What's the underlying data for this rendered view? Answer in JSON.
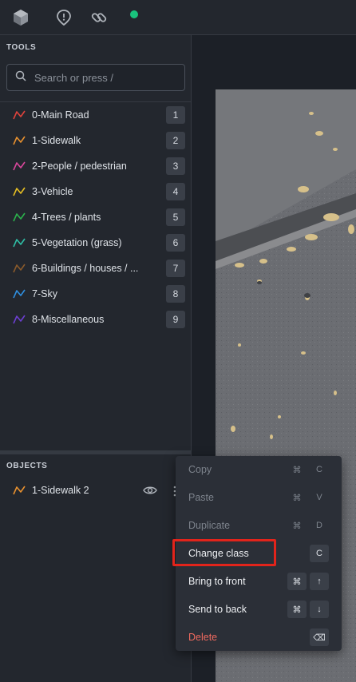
{
  "topbar": {
    "icons": [
      "cube-logo-icon",
      "alert-marker-icon",
      "link-icon",
      "status-dot-icon"
    ],
    "status_color": "#19c37d"
  },
  "tools_panel": {
    "title": "TOOLS",
    "search_placeholder": "Search or press /",
    "items": [
      {
        "label": "0-Main Road",
        "key": "1",
        "color": "#e0433c"
      },
      {
        "label": "1-Sidewalk",
        "key": "2",
        "color": "#e8912f"
      },
      {
        "label": "2-People / pedestrian",
        "key": "3",
        "color": "#d9479c"
      },
      {
        "label": "3-Vehicle",
        "key": "4",
        "color": "#e6bf23"
      },
      {
        "label": "4-Trees / plants",
        "key": "5",
        "color": "#2bb24c"
      },
      {
        "label": "5-Vegetation (grass)",
        "key": "6",
        "color": "#2fbfa6"
      },
      {
        "label": "6-Buildings / houses / ...",
        "key": "7",
        "color": "#8a5a2b"
      },
      {
        "label": "7-Sky",
        "key": "8",
        "color": "#2f8fe0"
      },
      {
        "label": "8-Miscellaneous",
        "key": "9",
        "color": "#6c3fd1"
      }
    ]
  },
  "objects_panel": {
    "title": "OBJECTS",
    "items": [
      {
        "label": "1-Sidewalk 2",
        "color": "#e8912f"
      }
    ]
  },
  "context_menu": {
    "items": [
      {
        "label": "Copy",
        "keys": [
          "⌘",
          "C"
        ],
        "state": "disabled"
      },
      {
        "label": "Paste",
        "keys": [
          "⌘",
          "V"
        ],
        "state": "disabled"
      },
      {
        "label": "Duplicate",
        "keys": [
          "⌘",
          "D"
        ],
        "state": "disabled"
      },
      {
        "label": "Change class",
        "keys": [
          "C"
        ],
        "state": "enabled"
      },
      {
        "label": "Bring to front",
        "keys": [
          "⌘",
          "↑"
        ],
        "state": "enabled"
      },
      {
        "label": "Send to back",
        "keys": [
          "⌘",
          "↓"
        ],
        "state": "enabled"
      },
      {
        "label": "Delete",
        "keys": [
          "⌫"
        ],
        "state": "danger"
      }
    ],
    "highlighted_item": "Change class"
  }
}
